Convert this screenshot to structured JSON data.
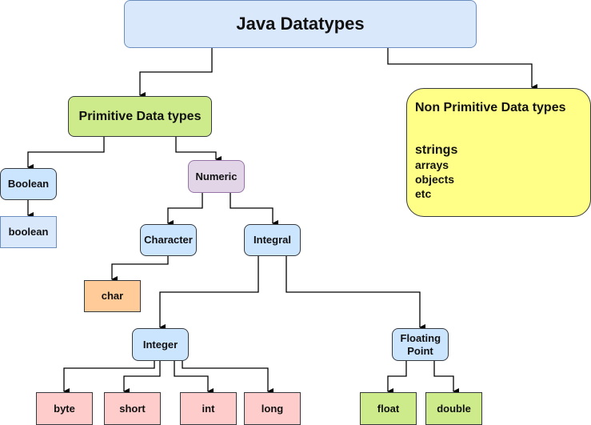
{
  "diagram": {
    "title": "Java Datatypes",
    "primitive": "Primitive Data types",
    "non_primitive": {
      "title": "Non Primitive Data types",
      "items": [
        "strings",
        "arrays",
        "objects",
        "etc"
      ]
    },
    "boolean_category": "Boolean",
    "boolean_type": "boolean",
    "numeric": "Numeric",
    "character_category": "Character",
    "char_type": "char",
    "integral": "Integral",
    "integer_category": "Integer",
    "floating_category": "Floating Point",
    "integer_types": [
      "byte",
      "short",
      "int",
      "long"
    ],
    "floating_types": [
      "float",
      "double"
    ]
  },
  "edges": [
    [
      "root",
      "primitive"
    ],
    [
      "root",
      "non-primitive"
    ],
    [
      "primitive",
      "boolean"
    ],
    [
      "primitive",
      "numeric"
    ],
    [
      "boolean",
      "boolean-type"
    ],
    [
      "numeric",
      "character"
    ],
    [
      "numeric",
      "integral"
    ],
    [
      "character",
      "char"
    ],
    [
      "integral",
      "integer"
    ],
    [
      "integral",
      "floating-point"
    ],
    [
      "integer",
      "byte"
    ],
    [
      "integer",
      "short"
    ],
    [
      "integer",
      "int"
    ],
    [
      "integer",
      "long"
    ],
    [
      "floating-point",
      "float"
    ],
    [
      "floating-point",
      "double"
    ]
  ]
}
